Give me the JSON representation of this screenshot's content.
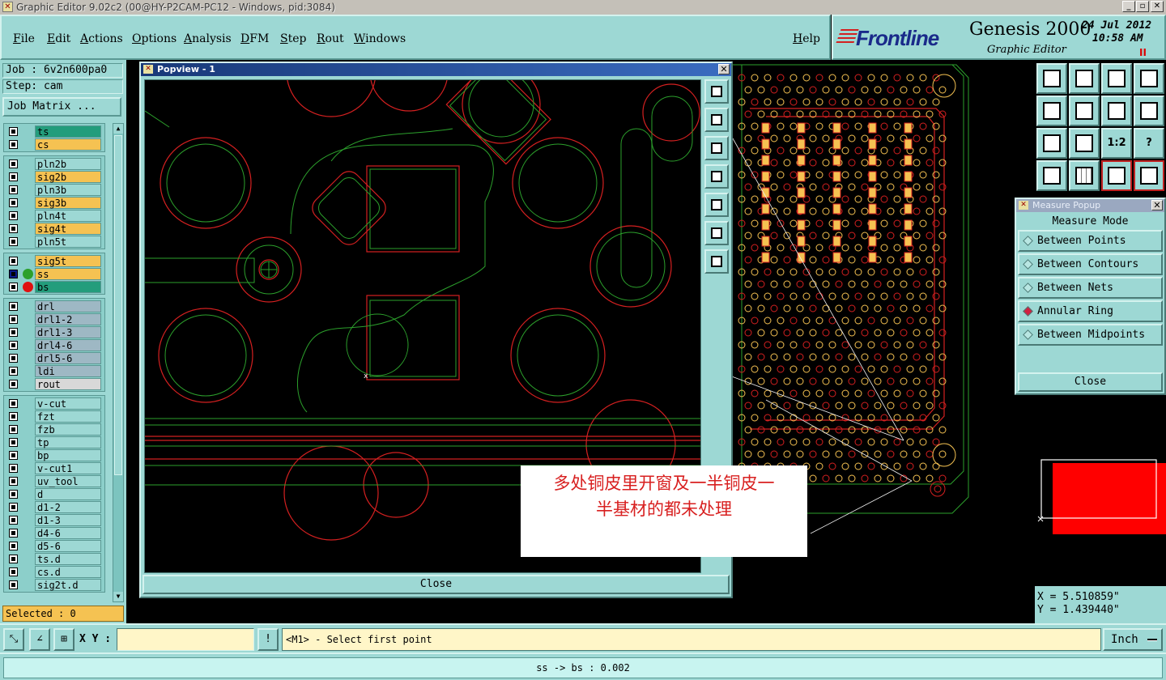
{
  "window": {
    "title": "Graphic Editor 9.02c2 (00@HY-P2CAM-PC12 - Windows, pid:3084)"
  },
  "menu": {
    "items": [
      "File",
      "Edit",
      "Actions",
      "Options",
      "Analysis",
      "DFM",
      "Step",
      "Rout",
      "Windows"
    ],
    "help": "Help"
  },
  "brand": {
    "logo": "Frontline",
    "product": "Genesis 2000",
    "module": "Graphic Editor",
    "date": "24 Jul 2012",
    "time": "10:58 AM",
    "pause": "II"
  },
  "job": {
    "name": "Job : 6v2n600pa0",
    "step": "Step: cam",
    "matrix_button": "Job Matrix ..."
  },
  "layer_groups": [
    {
      "layers": [
        {
          "name": "ts",
          "color": "#239d7c"
        },
        {
          "name": "cs",
          "color": "#f5c252"
        }
      ]
    },
    {
      "layers": [
        {
          "name": "pln2b",
          "color": "#9dd8d4"
        },
        {
          "name": "sig2b",
          "color": "#f5c252"
        },
        {
          "name": "pln3b",
          "color": "#9dd8d4"
        },
        {
          "name": "sig3b",
          "color": "#f5c252"
        },
        {
          "name": "pln4t",
          "color": "#9dd8d4"
        },
        {
          "name": "sig4t",
          "color": "#f5c252"
        },
        {
          "name": "pln5t",
          "color": "#9dd8d4"
        }
      ]
    },
    {
      "layers": [
        {
          "name": "sig5t",
          "color": "#f5c252"
        },
        {
          "name": "ss",
          "color": "#f5c252",
          "dot": "#2ca02c",
          "active": true
        },
        {
          "name": "bs",
          "color": "#239d7c",
          "dot": "#e01010"
        }
      ]
    },
    {
      "layers": [
        {
          "name": "drl",
          "color": "#9eb8c4"
        },
        {
          "name": "drl1-2",
          "color": "#9eb8c4"
        },
        {
          "name": "drl1-3",
          "color": "#9eb8c4"
        },
        {
          "name": "drl4-6",
          "color": "#9eb8c4"
        },
        {
          "name": "drl5-6",
          "color": "#9eb8c4"
        },
        {
          "name": "ldi",
          "color": "#9eb8c4"
        },
        {
          "name": "rout",
          "color": "#d8d8d8"
        }
      ]
    },
    {
      "layers": [
        {
          "name": "v-cut",
          "color": "#9dd8d4"
        },
        {
          "name": "fzt",
          "color": "#9dd8d4"
        },
        {
          "name": "fzb",
          "color": "#9dd8d4"
        },
        {
          "name": "tp",
          "color": "#9dd8d4"
        },
        {
          "name": "bp",
          "color": "#9dd8d4"
        },
        {
          "name": "v-cut1",
          "color": "#9dd8d4"
        },
        {
          "name": "uv_tool",
          "color": "#9dd8d4"
        },
        {
          "name": "d",
          "color": "#9dd8d4"
        },
        {
          "name": "d1-2",
          "color": "#9dd8d4"
        },
        {
          "name": "d1-3",
          "color": "#9dd8d4"
        },
        {
          "name": "d4-6",
          "color": "#9dd8d4"
        },
        {
          "name": "d5-6",
          "color": "#9dd8d4"
        },
        {
          "name": "ts.d",
          "color": "#9dd8d4"
        },
        {
          "name": "cs.d",
          "color": "#9dd8d4"
        },
        {
          "name": "sig2t.d",
          "color": "#9dd8d4"
        }
      ]
    }
  ],
  "selected": "Selected : 0",
  "popview": {
    "title": "Popview - 1",
    "close": "Close",
    "x_label": "x"
  },
  "measure": {
    "title": "Measure Popup",
    "heading": "Measure Mode",
    "options": [
      {
        "label": "Between Points",
        "on": false
      },
      {
        "label": "Between Contours",
        "on": false
      },
      {
        "label": "Between Nets",
        "on": false
      },
      {
        "label": "Annular Ring",
        "on": true
      },
      {
        "label": "Between Midpoints",
        "on": false
      }
    ],
    "close": "Close"
  },
  "right_tools": {
    "ratio_label": "1:2",
    "question": "?"
  },
  "coords": {
    "x": "X = 5.510859\"",
    "y": "Y = 1.439440\""
  },
  "bottom": {
    "xy_label": "X Y :",
    "xy_value": "",
    "bang": "!",
    "prompt": "<M1> - Select first point",
    "units": "Inch"
  },
  "status": "ss -> bs : 0.002",
  "annotation": {
    "line1": "多处铜皮里开窗及一半铜皮一",
    "line2": "半基材的都未处理"
  },
  "colors": {
    "panel": "#9dd8d4",
    "copper_outline": "#d42020",
    "mask_outline": "#2ca02c",
    "pad_fill": "#f5c252"
  }
}
